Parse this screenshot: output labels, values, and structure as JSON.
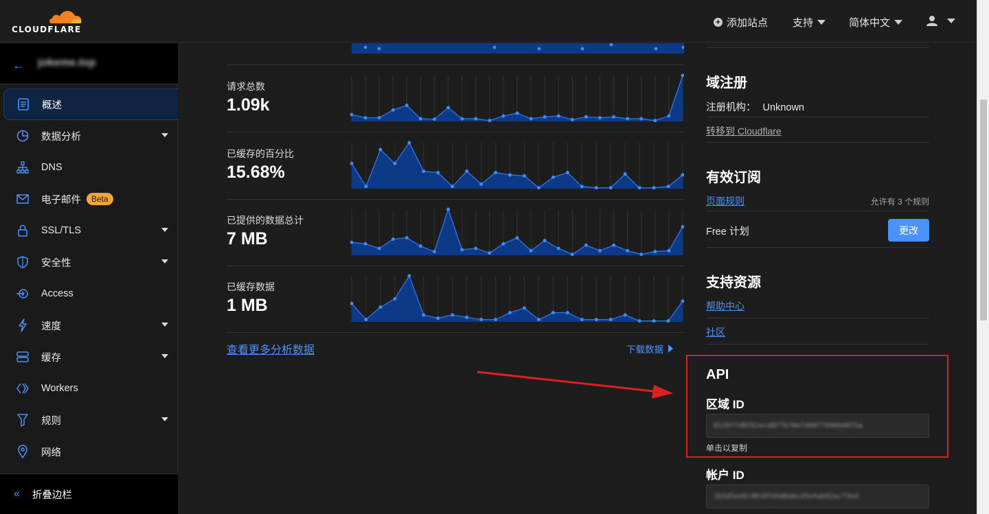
{
  "header": {
    "logo_text": "CLOUDFLARE",
    "add_site": "添加站点",
    "support": "支持",
    "language": "简体中文",
    "account_icon": "user-icon"
  },
  "sidebar": {
    "domain": "jokeme.top",
    "items": [
      {
        "label": "概述",
        "icon": "document-icon",
        "active": true
      },
      {
        "label": "数据分析",
        "icon": "pie-chart-icon",
        "caret": true
      },
      {
        "label": "DNS",
        "icon": "sitemap-icon"
      },
      {
        "label": "电子邮件",
        "icon": "mail-icon",
        "badge": "Beta"
      },
      {
        "label": "SSL/TLS",
        "icon": "lock-icon",
        "caret": true
      },
      {
        "label": "安全性",
        "icon": "shield-icon",
        "caret": true
      },
      {
        "label": "Access",
        "icon": "access-icon"
      },
      {
        "label": "速度",
        "icon": "lightning-icon",
        "caret": true
      },
      {
        "label": "缓存",
        "icon": "storage-icon",
        "caret": true
      },
      {
        "label": "Workers",
        "icon": "workers-icon"
      },
      {
        "label": "规则",
        "icon": "funnel-icon",
        "caret": true
      },
      {
        "label": "网络",
        "icon": "location-pin-icon"
      }
    ],
    "collapse": "折叠边栏"
  },
  "metrics": [
    {
      "label": "请求总数",
      "value": "1.09k",
      "series": [
        0.15,
        0.08,
        0.08,
        0.25,
        0.35,
        0.06,
        0.05,
        0.3,
        0.06,
        0.06,
        0.02,
        0.12,
        0.18,
        0.06,
        0.1,
        0.12,
        0.04,
        0.1,
        0.08,
        0.1,
        0.06,
        0.06,
        0.02,
        0.12,
        1.0
      ]
    },
    {
      "label": "已缓存的百分比",
      "value": "15.68%",
      "series": [
        0.55,
        0.05,
        0.85,
        0.55,
        1.0,
        0.38,
        0.35,
        0.05,
        0.38,
        0.1,
        0.35,
        0.3,
        0.28,
        0.02,
        0.25,
        0.35,
        0.05,
        0.02,
        0.02,
        0.32,
        0.02,
        0.02,
        0.05,
        0.3
      ]
    },
    {
      "label": "已提供的数据总计",
      "value": "7 MB",
      "series": [
        0.28,
        0.25,
        0.15,
        0.35,
        0.38,
        0.2,
        0.08,
        1.0,
        0.12,
        0.15,
        0.05,
        0.25,
        0.38,
        0.1,
        0.32,
        0.15,
        0.02,
        0.22,
        0.1,
        0.22,
        0.1,
        0.02,
        0.08,
        0.1,
        0.62
      ]
    },
    {
      "label": "已缓存数据",
      "value": "1 MB",
      "series": [
        0.4,
        0.05,
        0.32,
        0.5,
        1.0,
        0.15,
        0.08,
        0.15,
        0.1,
        0.05,
        0.05,
        0.2,
        0.3,
        0.05,
        0.2,
        0.2,
        0.05,
        0.05,
        0.05,
        0.15,
        0.02,
        0.02,
        0.02,
        0.45
      ]
    }
  ],
  "more_analytics": "查看更多分析数据",
  "download": "下载数据",
  "registration": {
    "title": "域注册",
    "registrar_label": "注册机构：",
    "registrar_value": "Unknown",
    "transfer": "转移到 Cloudflare"
  },
  "subscriptions": {
    "title": "有效订阅",
    "page_rules": "页面规则",
    "allowed": "允许有 3 个规则",
    "plan": "Free 计划",
    "change": "更改"
  },
  "resources": {
    "title": "支持资源",
    "help": "帮助中心",
    "community": "社区"
  },
  "api": {
    "title": "API",
    "zone_label": "区域 ID",
    "zone_id": "8120f7d8f62ecd8f7b70e7468f7090940f5a",
    "copy_hint": "单击以复制",
    "account_label": "帐户 ID",
    "account_id": "1b5d5ee6c0010fd4d0a6cd5e4ab92acf3ed"
  },
  "colors": {
    "accent": "#4a93ff",
    "chart_fill": "#0d3a87",
    "highlight": "#e02020"
  }
}
